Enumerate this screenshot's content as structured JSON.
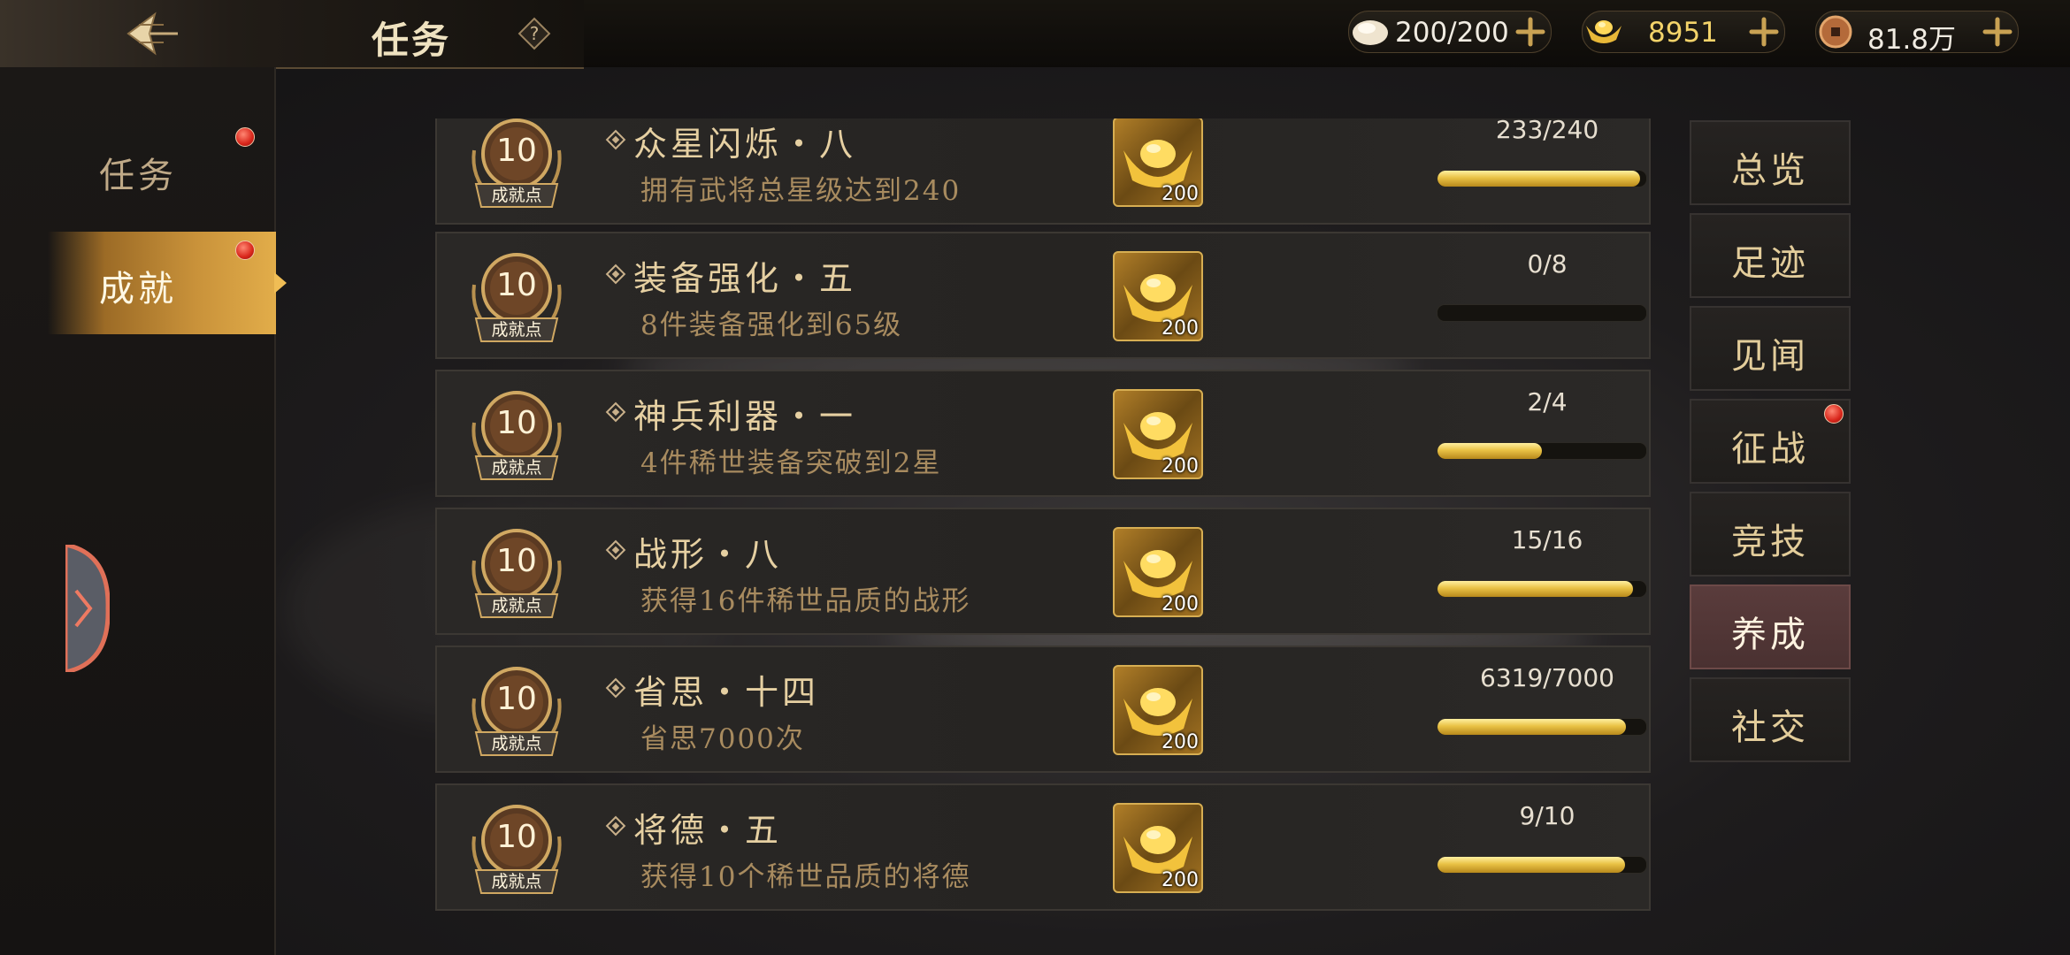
{
  "header": {
    "title": "任务",
    "resources": [
      {
        "name": "stamina",
        "value": "200/200",
        "icon": "bun-icon"
      },
      {
        "name": "gold-ingot",
        "value": "8951",
        "icon": "gold-ingot-icon",
        "color": "#f3d36a"
      },
      {
        "name": "copper-coin",
        "value": "81.8万",
        "icon": "copper-coin-icon"
      }
    ]
  },
  "sidebar": {
    "items": [
      {
        "label": "任务",
        "active": false,
        "badge": true
      },
      {
        "label": "成就",
        "active": true,
        "badge": true
      }
    ]
  },
  "achievements": [
    {
      "points": "10",
      "points_label": "成就点",
      "title": "众星闪烁・八",
      "desc": "拥有武将总星级达到240",
      "reward": "200",
      "progress_text": "233/240",
      "progress": 0.971
    },
    {
      "points": "10",
      "points_label": "成就点",
      "title": "装备强化・五",
      "desc": "8件装备强化到65级",
      "reward": "200",
      "progress_text": "0/8",
      "progress": 0.0
    },
    {
      "points": "10",
      "points_label": "成就点",
      "title": "神兵利器・一",
      "desc": "4件稀世装备突破到2星",
      "reward": "200",
      "progress_text": "2/4",
      "progress": 0.5
    },
    {
      "points": "10",
      "points_label": "成就点",
      "title": "战形・八",
      "desc": "获得16件稀世品质的战形",
      "reward": "200",
      "progress_text": "15/16",
      "progress": 0.9375
    },
    {
      "points": "10",
      "points_label": "成就点",
      "title": "省思・十四",
      "desc": "省思7000次",
      "reward": "200",
      "progress_text": "6319/7000",
      "progress": 0.903
    },
    {
      "points": "10",
      "points_label": "成就点",
      "title": "将德・五",
      "desc": "获得10个稀世品质的将德",
      "reward": "200",
      "progress_text": "9/10",
      "progress": 0.9
    }
  ],
  "tabs": [
    {
      "label": "总览",
      "active": false,
      "badge": false
    },
    {
      "label": "足迹",
      "active": false,
      "badge": false
    },
    {
      "label": "见闻",
      "active": false,
      "badge": false
    },
    {
      "label": "征战",
      "active": false,
      "badge": true
    },
    {
      "label": "竞技",
      "active": false,
      "badge": false
    },
    {
      "label": "养成",
      "active": true,
      "badge": false
    },
    {
      "label": "社交",
      "active": false,
      "badge": false
    }
  ],
  "colors": {
    "accent": "#e2ad4a",
    "progress": "#e9c245",
    "badge_red": "#d9261b"
  }
}
